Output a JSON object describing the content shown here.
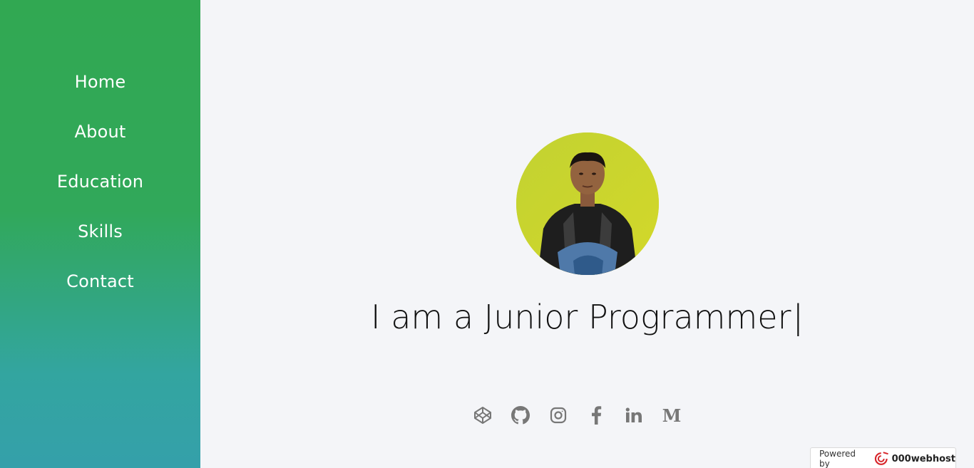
{
  "sidebar": {
    "items": [
      {
        "label": "Home"
      },
      {
        "label": "About"
      },
      {
        "label": "Education"
      },
      {
        "label": "Skills"
      },
      {
        "label": "Contact"
      }
    ]
  },
  "hero": {
    "tagline": "I am a Junior Programmer",
    "cursor": "|"
  },
  "socials": [
    {
      "icon": "codepen-icon"
    },
    {
      "icon": "github-icon"
    },
    {
      "icon": "instagram-icon"
    },
    {
      "icon": "facebook-icon"
    },
    {
      "icon": "linkedin-icon"
    },
    {
      "icon": "medium-icon",
      "glyph": "M"
    }
  ],
  "powered": {
    "prefix": "Powered by",
    "brand": "000webhost"
  },
  "colors": {
    "sidebar_top": "#31a852",
    "sidebar_bottom": "#34a0aa",
    "background": "#f4f5f8",
    "icon": "#777777"
  }
}
